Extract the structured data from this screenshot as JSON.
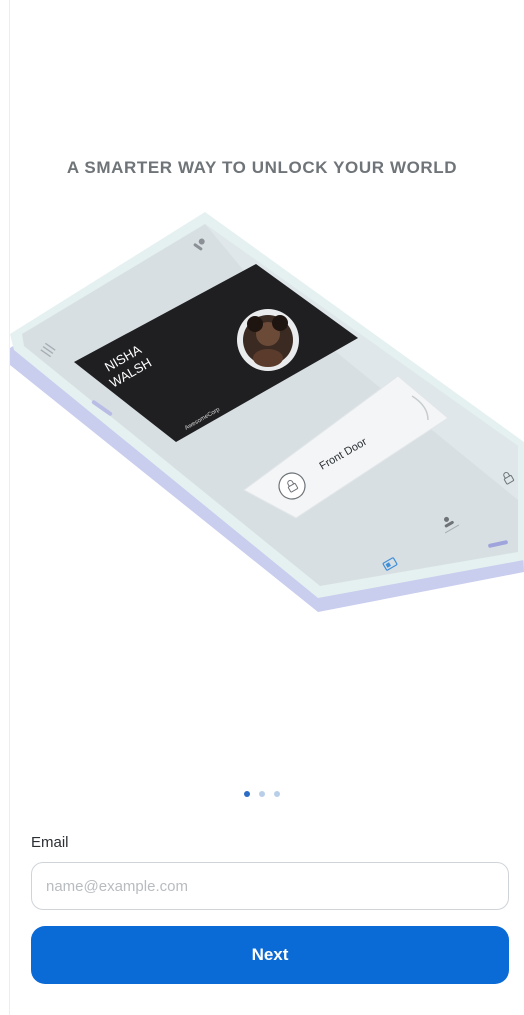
{
  "onboarding": {
    "headline": "A SMARTER WAY TO UNLOCK YOUR WORLD",
    "illustration": {
      "card_name_line1": "NISHA",
      "card_name_line2": "WALSH",
      "card_company": "AwesomeCorp",
      "door_label": "Front Door"
    },
    "pager": {
      "count": 3,
      "active_index": 0
    }
  },
  "form": {
    "email_label": "Email",
    "email_value": "",
    "email_placeholder": "name@example.com",
    "next_label": "Next"
  },
  "colors": {
    "primary": "#0a6ad6",
    "headline": "#6f7478",
    "dot_active": "#2b6cc4",
    "dot_inactive": "#b9cfe9"
  }
}
